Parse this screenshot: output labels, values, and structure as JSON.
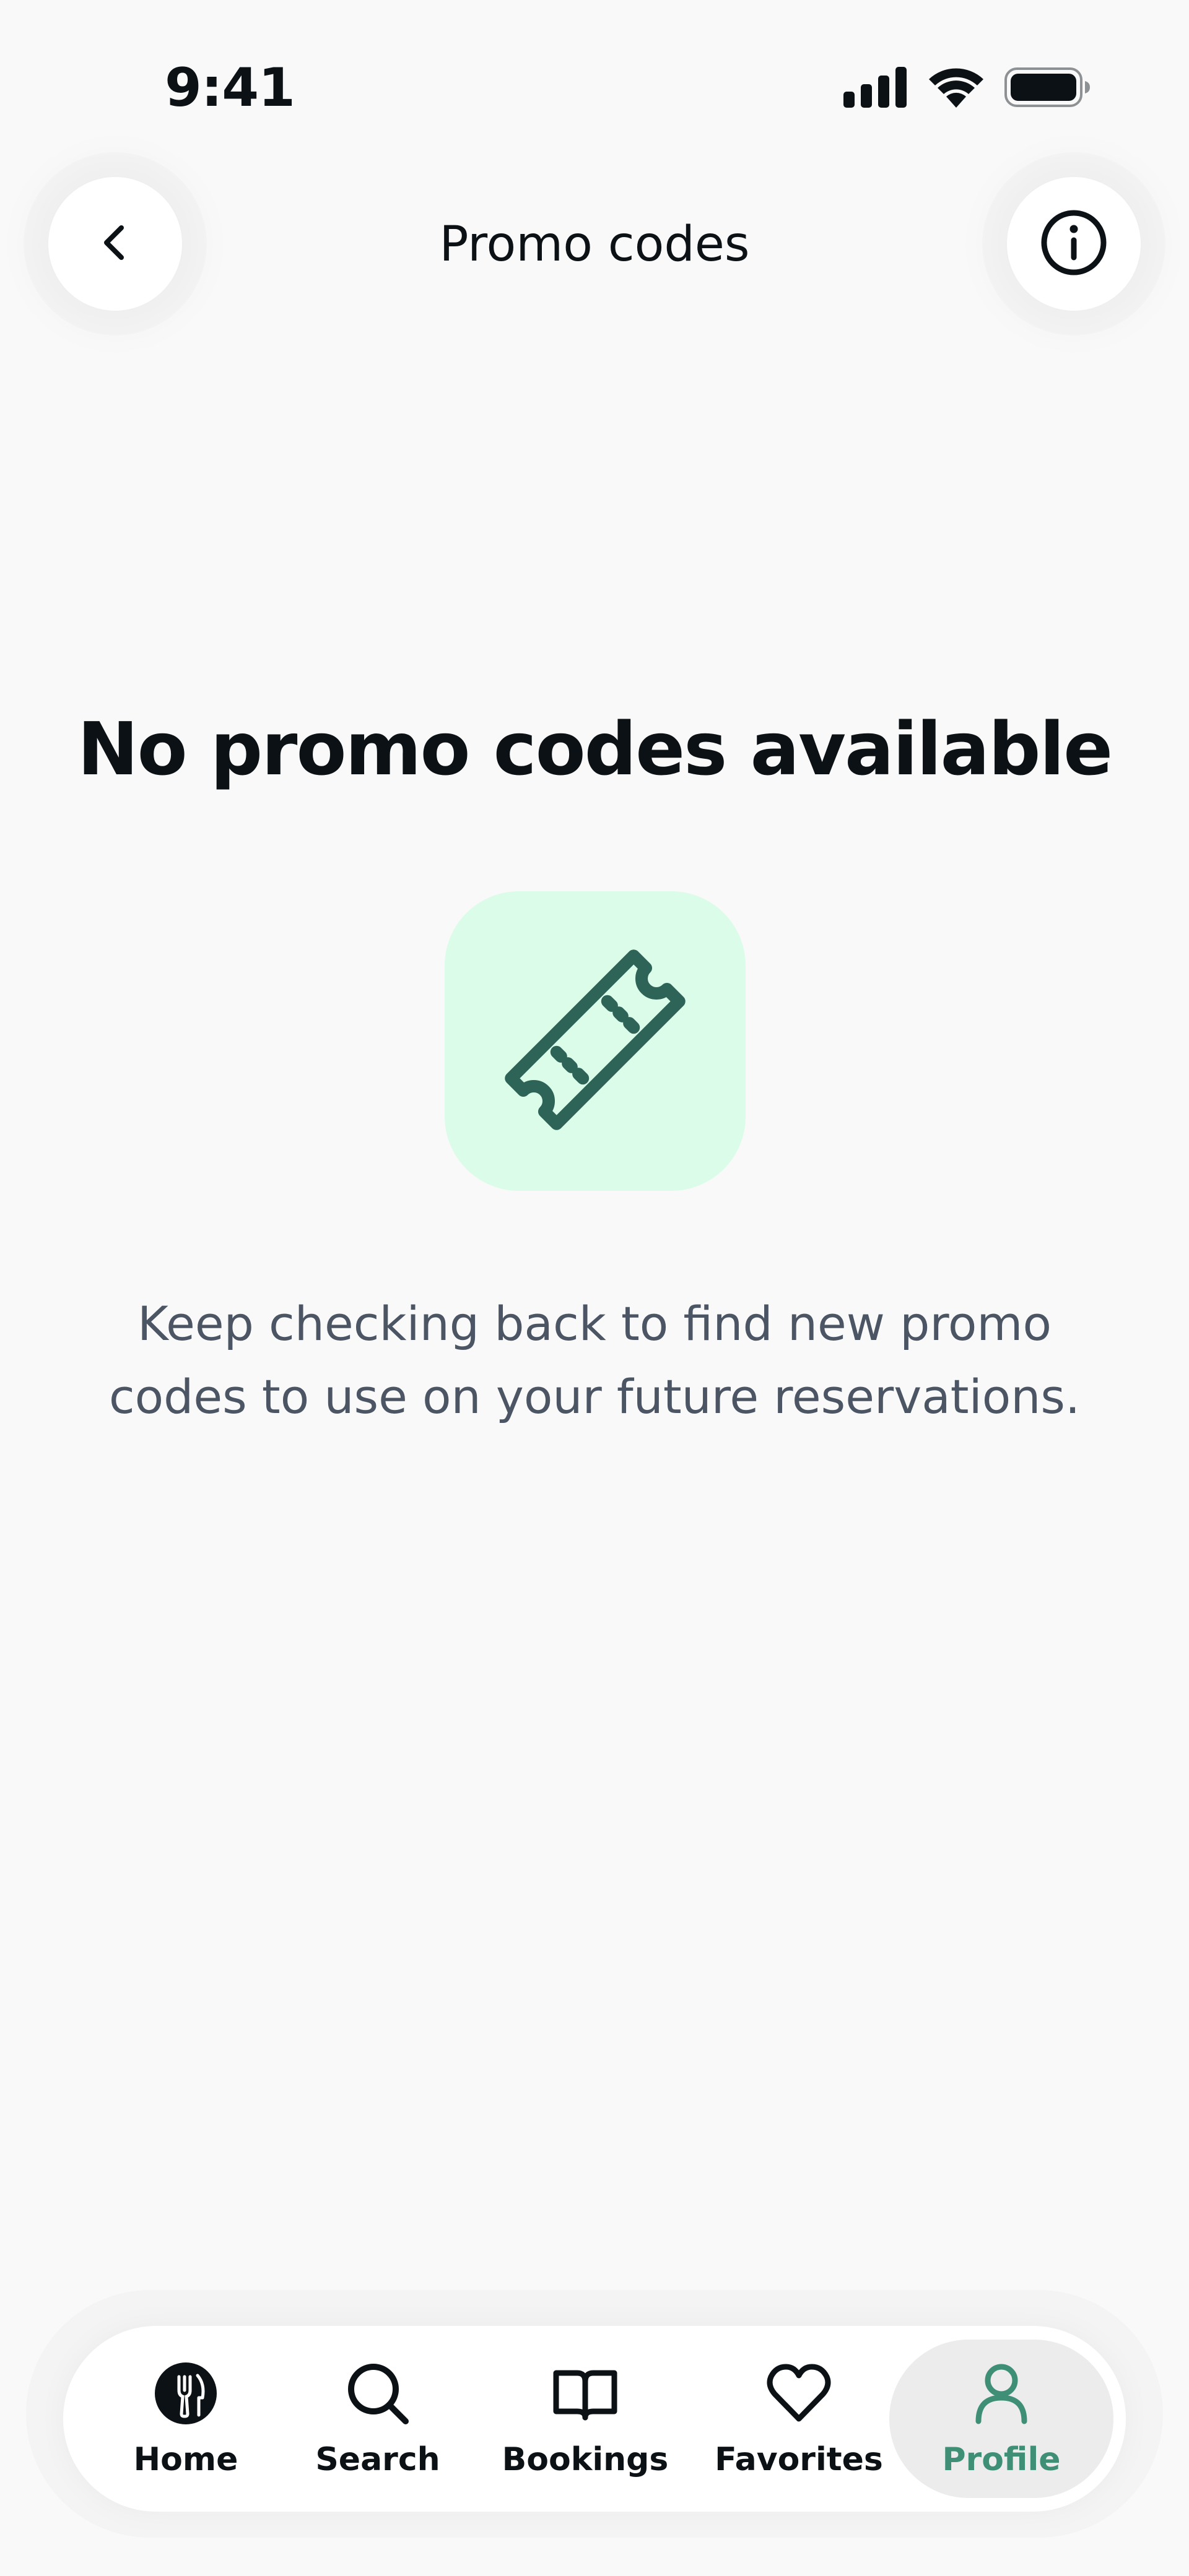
{
  "status_bar": {
    "time": "9:41"
  },
  "header": {
    "title": "Promo codes",
    "back_icon": "chevron-left-icon",
    "info_icon": "info-icon"
  },
  "empty_state": {
    "title": "No promo codes available",
    "icon": "ticket-icon",
    "description": "Keep checking back to find new promo codes to use on your future reservations."
  },
  "tab_bar": {
    "items": [
      {
        "label": "Home",
        "icon": "home-fork-icon",
        "active": false
      },
      {
        "label": "Search",
        "icon": "search-icon",
        "active": false
      },
      {
        "label": "Bookings",
        "icon": "book-icon",
        "active": false
      },
      {
        "label": "Favorites",
        "icon": "heart-icon",
        "active": false
      },
      {
        "label": "Profile",
        "icon": "user-icon",
        "active": true
      }
    ]
  },
  "colors": {
    "background": "#f9f9f9",
    "text_primary": "#0c1116",
    "text_secondary": "#4b5563",
    "accent": "#3f8f76",
    "ticket_icon": "#2e6358",
    "ticket_bg": "#dcfcea"
  }
}
